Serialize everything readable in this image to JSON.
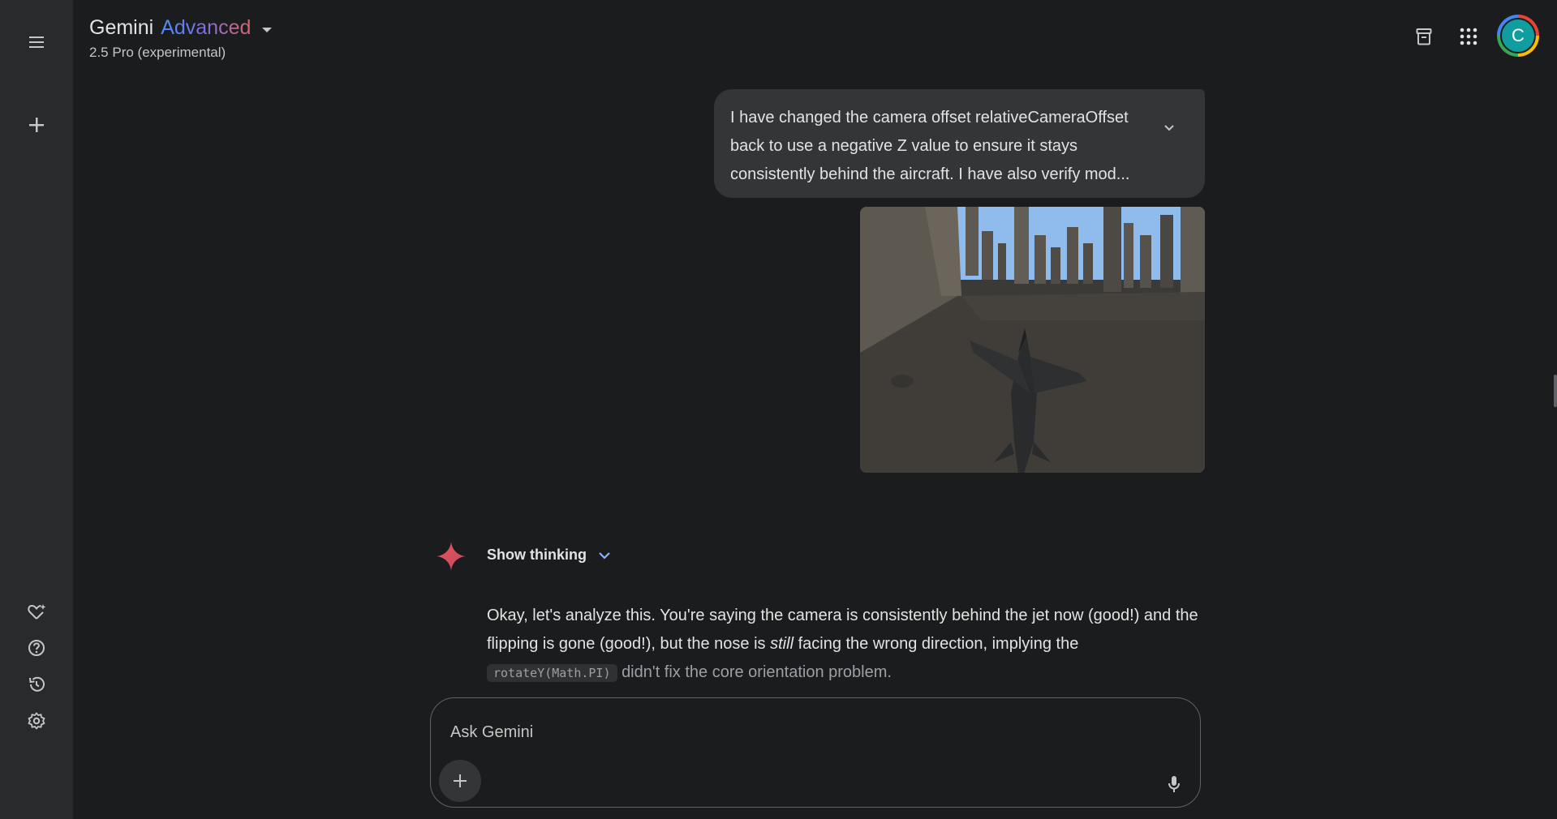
{
  "header": {
    "title_main": "Gemini",
    "title_accent": "Advanced",
    "model": "2.5 Pro (experimental)"
  },
  "sidebar": {
    "items": [
      {
        "icon": "menu-icon"
      },
      {
        "icon": "plus-icon"
      },
      {
        "icon": "gem-heart-icon"
      },
      {
        "icon": "help-icon"
      },
      {
        "icon": "history-icon"
      },
      {
        "icon": "gear-icon"
      }
    ]
  },
  "top_right": {
    "avatar_letter": "C",
    "icons": [
      "archive-icon",
      "apps-grid-icon"
    ]
  },
  "conversation": {
    "user_message": "I have changed the camera offset relativeCameraOffset back to use a negative Z value to ensure it stays consistently behind the aircraft. I have also verify mod...",
    "show_thinking_label": "Show thinking",
    "response": {
      "part1": "Okay, let's analyze this. You're saying the camera is consistently behind the jet now (good!) and the flipping is gone (good!), but the nose is ",
      "emphasis": "still",
      "part2": " facing the wrong direction, implying the ",
      "code": "rotateY(Math.PI)",
      "part3": " didn't fix the core orientation problem."
    }
  },
  "input": {
    "placeholder": "Ask Gemini",
    "value": ""
  },
  "colors": {
    "background": "#1b1c1d",
    "sidebar": "#282a2c",
    "bubble": "#333537",
    "accent_blue": "#4b90ff",
    "accent_pink": "#d96570"
  }
}
